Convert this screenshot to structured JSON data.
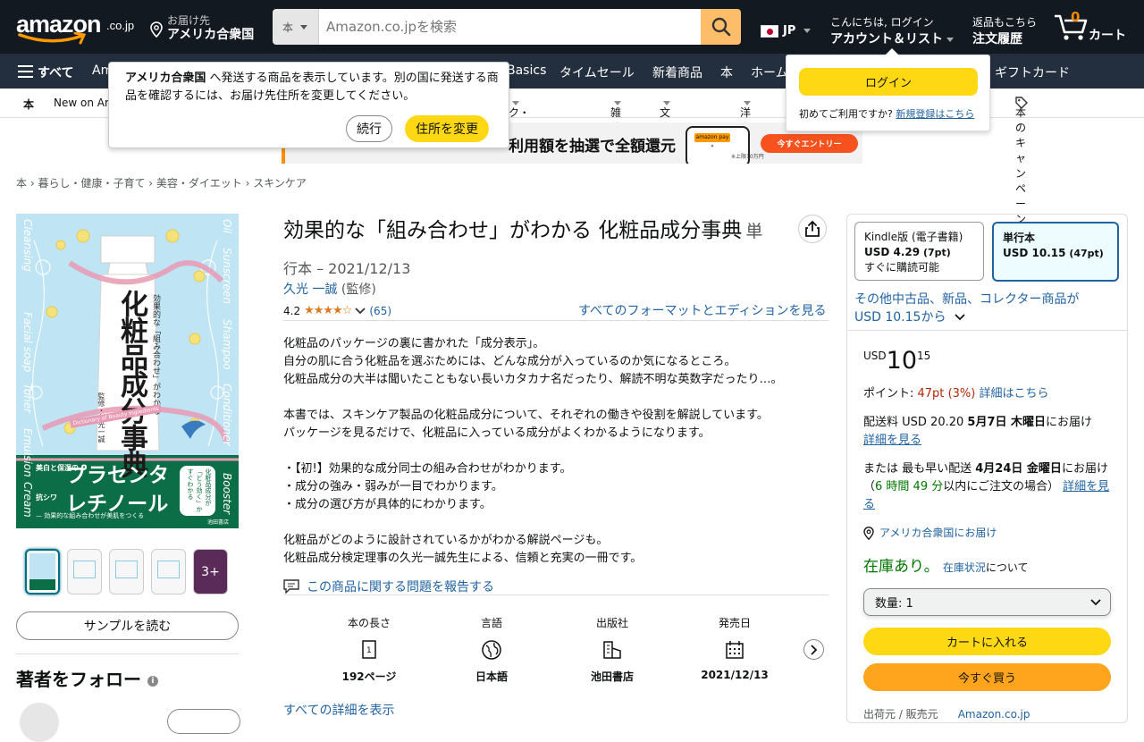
{
  "header": {
    "logo_text": "amazon",
    "logo_suffix": ".co.jp",
    "deliver_line1": "お届け先",
    "deliver_line2": "アメリカ合衆国",
    "search_category": "本",
    "search_placeholder": "Amazon.co.jpを検索",
    "language": "JP",
    "account_line1": "こんにちは, ログイン",
    "account_line2": "アカウント＆リスト",
    "orders_line1": "返品もこちら",
    "orders_line2": "注文履歴",
    "cart_count": "0",
    "cart_label": "カート"
  },
  "nav_main": {
    "all": "すべて",
    "items": [
      "Am",
      "Basics",
      "タイムセール",
      "新着商品",
      "本",
      "ホーム",
      "ギフトカード"
    ]
  },
  "nav_sub": {
    "items": [
      "本",
      "New on Am",
      "ク・ラノベ・BL",
      "雑誌",
      "文庫・新書",
      "洋書",
      "本のキャンペーン"
    ]
  },
  "address_popover": {
    "text_bold": "アメリカ合衆国",
    "text_rest": " へ発送する商品を表示しています。別の国に発送する商品を確認するには、お届け先住所を変更してください。",
    "continue_label": "続行",
    "change_label": "住所を変更"
  },
  "signin_popover": {
    "button": "ログイン",
    "new_customer": "初めてご利用ですか?",
    "register_link": "新規登録はこちら"
  },
  "banner": {
    "text": "利用額を抽選で全額還元",
    "cta": "今すぐエントリー",
    "note": "※上限10万円"
  },
  "breadcrumb": [
    "本",
    "暮らし・健康・子育て",
    "美容・ダイエット",
    "スキンケア"
  ],
  "cover": {
    "title": "化粧品成分事典",
    "subtitle": "効果的な「組み合わせ」がわかる",
    "editor": "監修・久光一誠",
    "english": "Dictionary of Beauty Ingredients",
    "band_left_top": "美白と保湿の",
    "band_big1": "プラセンタ",
    "band_left_bottom": "抗シワ",
    "band_big2": "レチノール",
    "band_tag": "化粧品成分が「どう効く」かすぐわかる",
    "band_footer": "— 効果的な組み合わせが美肌をつくる",
    "publisher": "池田書店",
    "side_words": [
      "Oil",
      "Sunscreen",
      "Shampoo",
      "Conditioner",
      "Booster",
      "Cream",
      "Emulsion",
      "Toner",
      "Facial soap",
      "Cleansing"
    ]
  },
  "thumbs_more": "3+",
  "sample_button": "サンプルを読む",
  "follow_title": "著者をフォロー",
  "product": {
    "title": "効果的な「組み合わせ」がわかる 化粧品成分事典",
    "format_tag": "単",
    "format_date": "行本 – 2021/12/13",
    "author_name": "久光 一誠",
    "author_role": " (監修)",
    "rating_value": "4.2",
    "stars": "★★★★☆",
    "rating_count": "(65)",
    "all_formats": "すべてのフォーマットとエディションを見る"
  },
  "description": [
    "化粧品のパッケージの裏に書かれた「成分表示」。",
    "自分の肌に合う化粧品を選ぶためには、どんな成分が入っているのか気になるところ。",
    "化粧品成分の大半は聞いたこともない長いカタカナ名だったり、解読不明な英数字だったり…。",
    "",
    "本書では、スキンケア製品の化粧品成分について、それぞれの働きや役割を解説しています。",
    "パッケージを見るだけで、化粧品に入っている成分がよくわかるようになります。",
    "",
    "・【初!】効果的な成分同士の組み合わせがわかります。",
    "・成分の強み・弱みが一目でわかります。",
    "・成分の選び方が具体的にわかります。",
    "",
    "化粧品がどのように設計されているかがわかる解説ページも。",
    "化粧品成分検定理事の久光一誠先生による、信頼と充実の一冊です。"
  ],
  "report_link": "この商品に関する問題を報告する",
  "specs": [
    {
      "label": "本の長さ",
      "value": "192ページ",
      "icon": "page-count-icon"
    },
    {
      "label": "言語",
      "value": "日本語",
      "icon": "globe-icon"
    },
    {
      "label": "出版社",
      "value": "池田書店",
      "icon": "building-icon"
    },
    {
      "label": "発売日",
      "value": "2021/12/13",
      "icon": "calendar-icon"
    }
  ],
  "all_details_link": "すべての詳細を表示",
  "buybox": {
    "kindle_label": "Kindle版 (電子書籍)",
    "kindle_price": "USD 4.29",
    "kindle_points": "(7pt)",
    "kindle_note": "すぐに購読可能",
    "paper_label": "単行本",
    "paper_price": "USD 10.15",
    "paper_points": "(47pt)",
    "other_offers_1": "その他中古品、新品、コレクター商品が",
    "other_offers_2": "USD 10.15から",
    "price_currency": "USD",
    "price_whole": "10",
    "price_fraction": "15",
    "points_label": "ポイント: ",
    "points_value": "47pt",
    "points_pct": "(3%)",
    "points_link": "詳細はこちら",
    "shipping_pre": "配送料 USD 20.20 ",
    "shipping_date": "5月7日 木曜日",
    "shipping_post": "にお届け",
    "shipping_link": "詳細を見る",
    "fast_pre": "または 最も早い配送 ",
    "fast_date": "4月24日 金曜日",
    "fast_post": "にお届け（",
    "fast_time": "6 時間 49 分",
    "fast_post2": "以内にご注文の場合）",
    "fast_link": "詳細を見る",
    "location_link": "アメリカ合衆国にお届け",
    "stock": "在庫あり。",
    "stock_link": "在庫状況",
    "stock_post": "について",
    "qty_label": "数量: 1",
    "add_to_cart": "カートに入れる",
    "buy_now": "今すぐ買う",
    "seller_label": "出荷元 / 販売元",
    "seller_value": "Amazon.co.jp"
  },
  "colors": {
    "nav_dark": "#131921",
    "nav_secondary": "#232f3e",
    "search_button": "#febd69",
    "cta_yellow": "#ffd814",
    "cta_orange": "#ffa41c",
    "link": "#2162a1",
    "stock_green": "#007600",
    "star": "#de7921",
    "points_red": "#b12704"
  }
}
